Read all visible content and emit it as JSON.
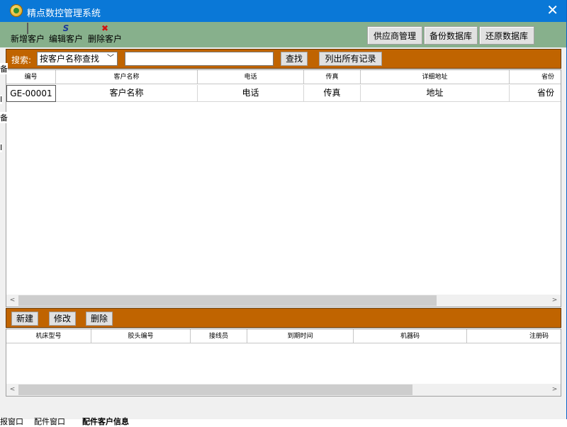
{
  "window": {
    "title": "精点数控管理系统"
  },
  "toolbar": {
    "new_customer": "新增客户",
    "edit_customer": "编辑客户",
    "delete_customer": "删除客户",
    "edit_glyph": "S",
    "delete_glyph": "✖",
    "supplier_management": "供应商管理",
    "backup_database": "备份数据库",
    "restore_database": "还原数据库"
  },
  "search": {
    "label": "搜索:",
    "mode_selected": "按客户名称查找",
    "query_value": "",
    "find_button": "查找",
    "list_all_button": "列出所有记录"
  },
  "customers_table": {
    "columns": [
      "编号",
      "客户名称",
      "电话",
      "传真",
      "详细地址",
      "省份"
    ],
    "rows": [
      [
        "GE-00001",
        "客户名称",
        "电话",
        "传真",
        "地址",
        "省份"
      ]
    ]
  },
  "detail_actions": {
    "new_button": "新建",
    "modify_button": "修改",
    "delete_button": "删除"
  },
  "machines_table": {
    "columns": [
      "机床型号",
      "胶头编号",
      "接线员",
      "到期时间",
      "机器码",
      "注册码"
    ]
  },
  "status_tabs": [
    "报窗口",
    "配件窗口",
    "配件客户信息"
  ],
  "stray_left_chars": [
    "备",
    "I",
    "备",
    "I"
  ]
}
